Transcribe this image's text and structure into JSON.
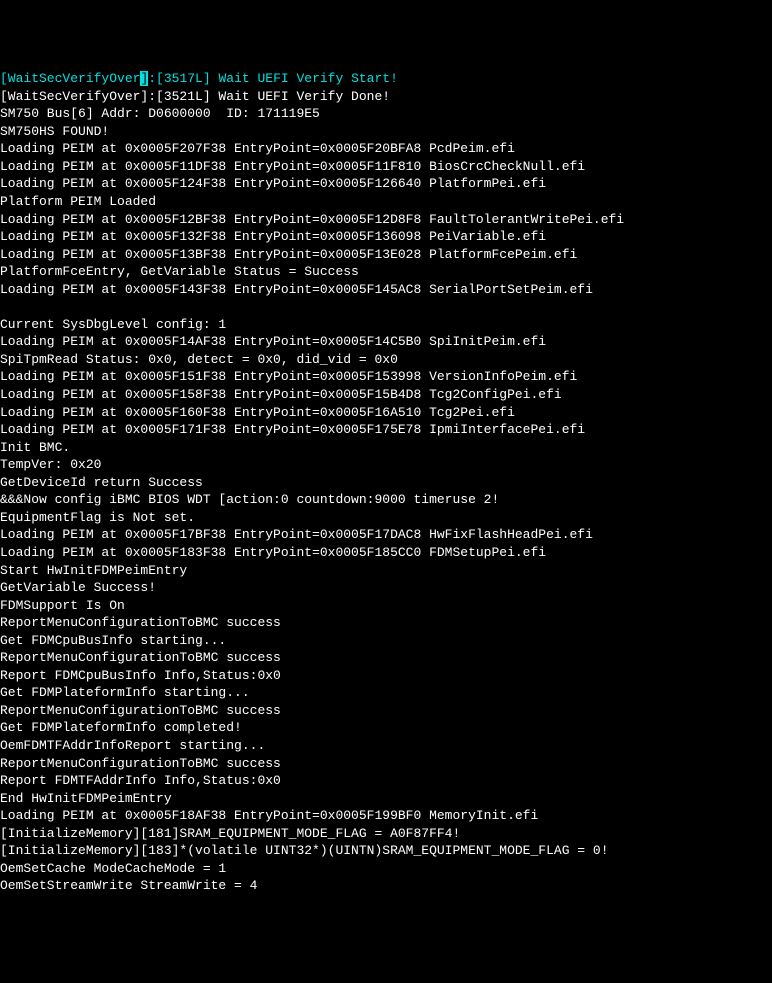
{
  "terminal": {
    "lines": [
      {
        "segments": [
          {
            "cls": "cyan",
            "text": "[WaitSecVerifyOver"
          },
          {
            "cls": "cyan-bg",
            "text": "]"
          },
          {
            "cls": "cyan",
            "text": ":[3517L] Wait UEFI Verify Start!"
          }
        ]
      },
      {
        "segments": [
          {
            "cls": "white",
            "text": "[WaitSecVerifyOver]:[3521L] Wait UEFI Verify Done!"
          }
        ]
      },
      {
        "segments": [
          {
            "cls": "white",
            "text": "SM750 Bus[6] Addr: D0600000  ID: 171119E5"
          }
        ]
      },
      {
        "segments": [
          {
            "cls": "white",
            "text": "SM750HS FOUND!"
          }
        ]
      },
      {
        "segments": [
          {
            "cls": "white",
            "text": "Loading PEIM at 0x0005F207F38 EntryPoint=0x0005F20BFA8 PcdPeim.efi"
          }
        ]
      },
      {
        "segments": [
          {
            "cls": "white",
            "text": "Loading PEIM at 0x0005F11DF38 EntryPoint=0x0005F11F810 BiosCrcCheckNull.efi"
          }
        ]
      },
      {
        "segments": [
          {
            "cls": "white",
            "text": "Loading PEIM at 0x0005F124F38 EntryPoint=0x0005F126640 PlatformPei.efi"
          }
        ]
      },
      {
        "segments": [
          {
            "cls": "white",
            "text": "Platform PEIM Loaded"
          }
        ]
      },
      {
        "segments": [
          {
            "cls": "white",
            "text": "Loading PEIM at 0x0005F12BF38 EntryPoint=0x0005F12D8F8 FaultTolerantWritePei.efi"
          }
        ]
      },
      {
        "segments": [
          {
            "cls": "white",
            "text": "Loading PEIM at 0x0005F132F38 EntryPoint=0x0005F136098 PeiVariable.efi"
          }
        ]
      },
      {
        "segments": [
          {
            "cls": "white",
            "text": "Loading PEIM at 0x0005F13BF38 EntryPoint=0x0005F13E028 PlatformFcePeim.efi"
          }
        ]
      },
      {
        "segments": [
          {
            "cls": "white",
            "text": "PlatformFceEntry, GetVariable Status = Success"
          }
        ]
      },
      {
        "segments": [
          {
            "cls": "white",
            "text": "Loading PEIM at 0x0005F143F38 EntryPoint=0x0005F145AC8 SerialPortSetPeim.efi"
          }
        ]
      },
      {
        "segments": [
          {
            "cls": "white",
            "text": " "
          }
        ]
      },
      {
        "segments": [
          {
            "cls": "white",
            "text": "Current SysDbgLevel config: 1"
          }
        ]
      },
      {
        "segments": [
          {
            "cls": "white",
            "text": "Loading PEIM at 0x0005F14AF38 EntryPoint=0x0005F14C5B0 SpiInitPeim.efi"
          }
        ]
      },
      {
        "segments": [
          {
            "cls": "white",
            "text": "SpiTpmRead Status: 0x0, detect = 0x0, did_vid = 0x0"
          }
        ]
      },
      {
        "segments": [
          {
            "cls": "white",
            "text": "Loading PEIM at 0x0005F151F38 EntryPoint=0x0005F153998 VersionInfoPeim.efi"
          }
        ]
      },
      {
        "segments": [
          {
            "cls": "white",
            "text": "Loading PEIM at 0x0005F158F38 EntryPoint=0x0005F15B4D8 Tcg2ConfigPei.efi"
          }
        ]
      },
      {
        "segments": [
          {
            "cls": "white",
            "text": "Loading PEIM at 0x0005F160F38 EntryPoint=0x0005F16A510 Tcg2Pei.efi"
          }
        ]
      },
      {
        "segments": [
          {
            "cls": "white",
            "text": "Loading PEIM at 0x0005F171F38 EntryPoint=0x0005F175E78 IpmiInterfacePei.efi"
          }
        ]
      },
      {
        "segments": [
          {
            "cls": "white",
            "text": "Init BMC."
          }
        ]
      },
      {
        "segments": [
          {
            "cls": "white",
            "text": "TempVer: 0x20"
          }
        ]
      },
      {
        "segments": [
          {
            "cls": "white",
            "text": "GetDeviceId return Success"
          }
        ]
      },
      {
        "segments": [
          {
            "cls": "white",
            "text": "&&&Now config iBMC BIOS WDT [action:0 countdown:9000 timeruse 2!"
          }
        ]
      },
      {
        "segments": [
          {
            "cls": "white",
            "text": "EquipmentFlag is Not set."
          }
        ]
      },
      {
        "segments": [
          {
            "cls": "white",
            "text": "Loading PEIM at 0x0005F17BF38 EntryPoint=0x0005F17DAC8 HwFixFlashHeadPei.efi"
          }
        ]
      },
      {
        "segments": [
          {
            "cls": "white",
            "text": "Loading PEIM at 0x0005F183F38 EntryPoint=0x0005F185CC0 FDMSetupPei.efi"
          }
        ]
      },
      {
        "segments": [
          {
            "cls": "white",
            "text": "Start HwInitFDMPeimEntry"
          }
        ]
      },
      {
        "segments": [
          {
            "cls": "white",
            "text": "GetVariable Success!"
          }
        ]
      },
      {
        "segments": [
          {
            "cls": "white",
            "text": "FDMSupport Is On"
          }
        ]
      },
      {
        "segments": [
          {
            "cls": "white",
            "text": "ReportMenuConfigurationToBMC success"
          }
        ]
      },
      {
        "segments": [
          {
            "cls": "white",
            "text": "Get FDMCpuBusInfo starting..."
          }
        ]
      },
      {
        "segments": [
          {
            "cls": "white",
            "text": "ReportMenuConfigurationToBMC success"
          }
        ]
      },
      {
        "segments": [
          {
            "cls": "white",
            "text": "Report FDMCpuBusInfo Info,Status:0x0"
          }
        ]
      },
      {
        "segments": [
          {
            "cls": "white",
            "text": "Get FDMPlateformInfo starting..."
          }
        ]
      },
      {
        "segments": [
          {
            "cls": "white",
            "text": "ReportMenuConfigurationToBMC success"
          }
        ]
      },
      {
        "segments": [
          {
            "cls": "white",
            "text": "Get FDMPlateformInfo completed!"
          }
        ]
      },
      {
        "segments": [
          {
            "cls": "white",
            "text": "OemFDMTFAddrInfoReport starting..."
          }
        ]
      },
      {
        "segments": [
          {
            "cls": "white",
            "text": "ReportMenuConfigurationToBMC success"
          }
        ]
      },
      {
        "segments": [
          {
            "cls": "white",
            "text": "Report FDMTFAddrInfo Info,Status:0x0"
          }
        ]
      },
      {
        "segments": [
          {
            "cls": "white",
            "text": "End HwInitFDMPeimEntry"
          }
        ]
      },
      {
        "segments": [
          {
            "cls": "white",
            "text": "Loading PEIM at 0x0005F18AF38 EntryPoint=0x0005F199BF0 MemoryInit.efi"
          }
        ]
      },
      {
        "segments": [
          {
            "cls": "white",
            "text": "[InitializeMemory][181]SRAM_EQUIPMENT_MODE_FLAG = A0F87FF4!"
          }
        ]
      },
      {
        "segments": [
          {
            "cls": "white",
            "text": "[InitializeMemory][183]*(volatile UINT32*)(UINTN)SRAM_EQUIPMENT_MODE_FLAG = 0!"
          }
        ]
      },
      {
        "segments": [
          {
            "cls": "white",
            "text": "OemSetCache ModeCacheMode = 1"
          }
        ]
      },
      {
        "segments": [
          {
            "cls": "white",
            "text": "OemSetStreamWrite StreamWrite = 4"
          }
        ]
      }
    ]
  }
}
